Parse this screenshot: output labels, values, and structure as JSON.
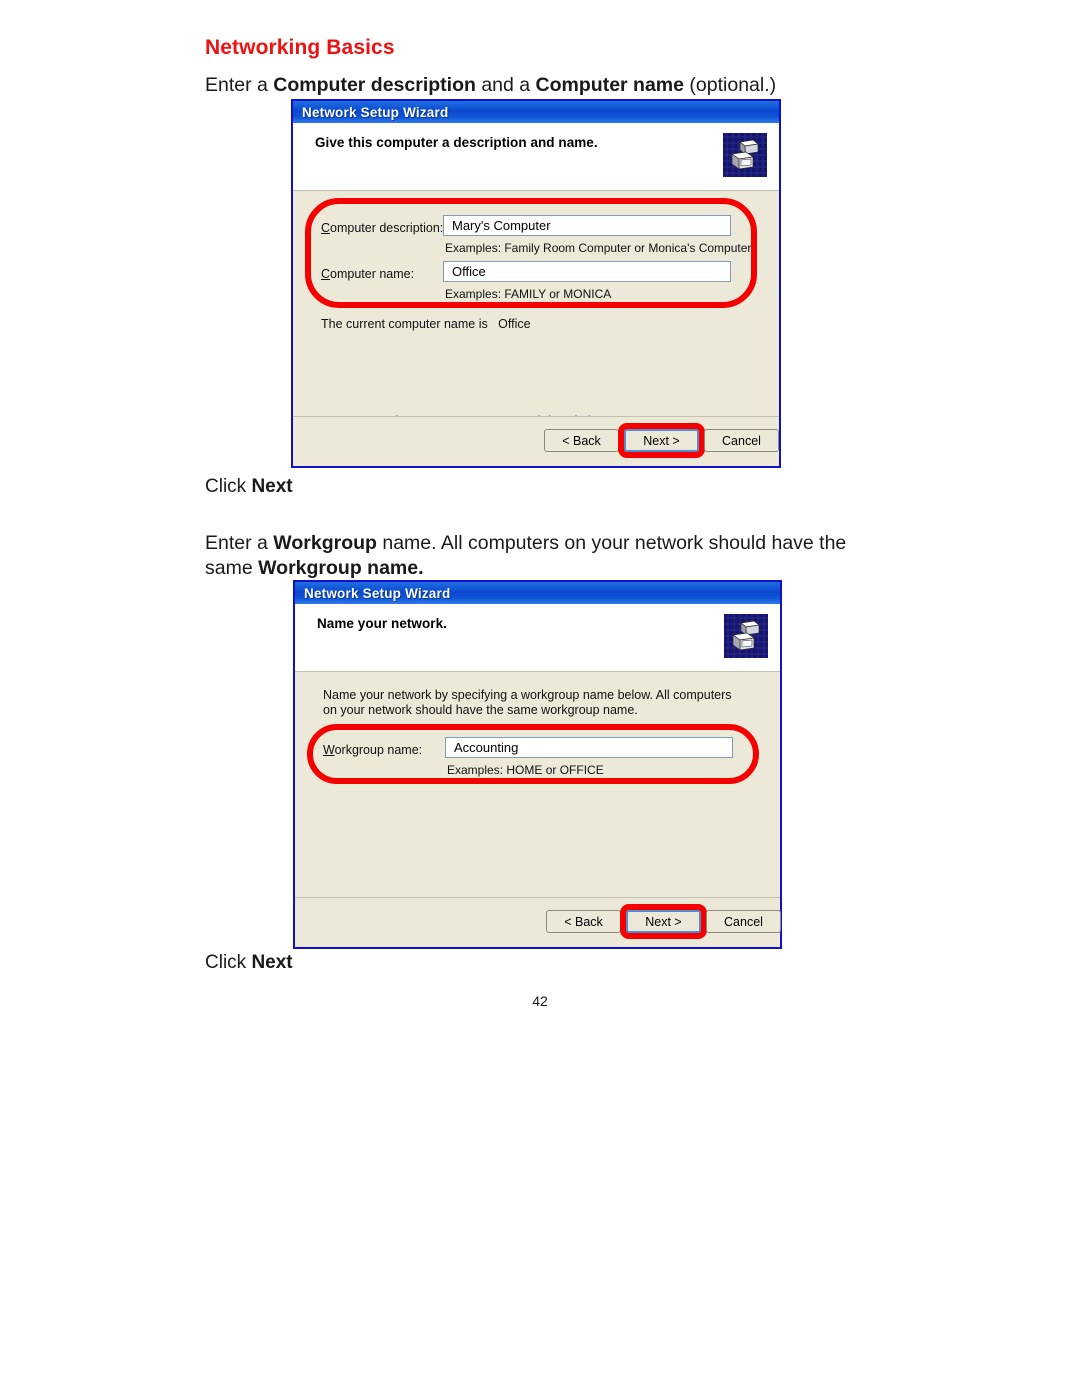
{
  "document": {
    "title": "Networking Basics",
    "page_number": "42",
    "intro_1": {
      "prefix": "Enter a ",
      "bold_1": "Computer description",
      "middle": " and a ",
      "bold_2": "Computer name",
      "suffix": " (optional.)"
    },
    "intro_2": {
      "prefix": "Enter a ",
      "bold_1": "Workgroup",
      "middle": " name.  All computers on your network should have the same ",
      "bold_2": "Workgroup name."
    },
    "click_next_1": {
      "prefix": "Click ",
      "bold": "Next"
    },
    "click_next_2": {
      "prefix": "Click ",
      "bold": "Next"
    }
  },
  "colors": {
    "title_red": "#ee1111",
    "highlight_red": "#f50000",
    "window_border_blue": "#1111cc",
    "titlebar_blue": "#0a49cf",
    "dialog_face": "#ece9d8",
    "input_border": "#7f9db9",
    "link_blue": "#0000cc"
  },
  "wizard_1": {
    "window_title": "Network Setup Wizard",
    "header_title": "Give this computer a description and name.",
    "header_icon": "computers-network-icon",
    "fields": [
      {
        "label": "Computer description:",
        "label_accel": "C",
        "value": "Mary's Computer",
        "example": "Examples: Family Room Computer or Monica's Computer"
      },
      {
        "label": "Computer name:",
        "label_accel": "C",
        "value": "Office",
        "example": "Examples: FAMILY or MONICA"
      }
    ],
    "current_name_label": "The current computer name is",
    "current_name_value": "Office",
    "learn_more_prefix": "Learn more about ",
    "learn_more_link": "computer names and descriptions",
    "learn_more_suffix": ".",
    "buttons": {
      "back": "< Back",
      "next": "Next >",
      "cancel": "Cancel",
      "default": "next"
    }
  },
  "wizard_2": {
    "window_title": "Network Setup Wizard",
    "header_title": "Name your network.",
    "header_icon": "computers-network-icon",
    "description": "Name your network by specifying a workgroup name below. All computers on your network should have the same workgroup name.",
    "fields": [
      {
        "label": "Workgroup name:",
        "label_accel": "W",
        "value": "Accounting",
        "example": "Examples: HOME or OFFICE"
      }
    ],
    "buttons": {
      "back": "< Back",
      "next": "Next >",
      "cancel": "Cancel",
      "default": "next"
    }
  }
}
